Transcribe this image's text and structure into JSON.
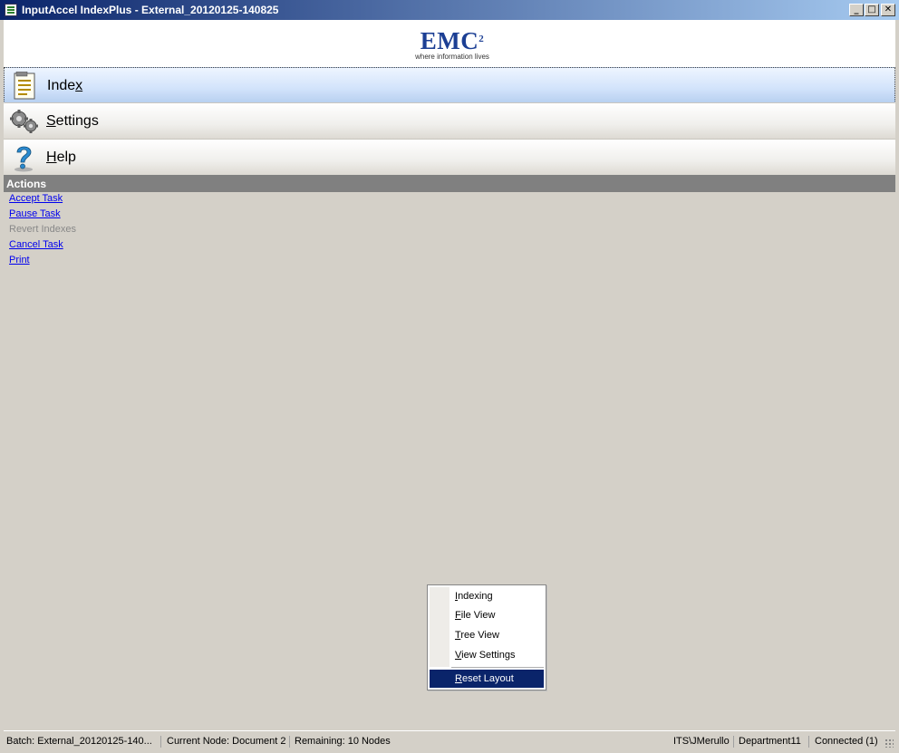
{
  "window": {
    "title": "InputAccel IndexPlus - External_20120125-140825",
    "controls": {
      "minimize": "_",
      "maximize": "□",
      "close": "✕"
    }
  },
  "logo": {
    "brand": "EMC",
    "superscript": "2",
    "tagline": "where information lives"
  },
  "nav": [
    {
      "label_pre": "Inde",
      "label_key": "x",
      "label_post": "",
      "icon": "document-icon",
      "selected": true
    },
    {
      "label_pre": "",
      "label_key": "S",
      "label_post": "ettings",
      "icon": "gears-icon",
      "selected": false
    },
    {
      "label_pre": "",
      "label_key": "H",
      "label_post": "elp",
      "icon": "question-icon",
      "selected": false
    }
  ],
  "actions": {
    "header": "Actions",
    "items": [
      {
        "label": "Accept Task",
        "enabled": true
      },
      {
        "label": "Pause Task",
        "enabled": true
      },
      {
        "label": "Revert Indexes",
        "enabled": false
      },
      {
        "label": "Cancel Task",
        "enabled": true
      },
      {
        "label": "Print",
        "enabled": true
      }
    ]
  },
  "context_menu": {
    "items": [
      {
        "key": "I",
        "rest": "ndexing"
      },
      {
        "key": "F",
        "rest": "ile View"
      },
      {
        "key": "T",
        "rest": "ree View"
      },
      {
        "key": "V",
        "rest": "iew Settings"
      }
    ],
    "highlighted": {
      "key": "R",
      "rest": "eset Layout"
    }
  },
  "status": {
    "batch": "Batch: External_20120125-140...",
    "current_node": "Current Node: Document 2",
    "remaining": "Remaining: 10 Nodes",
    "user": "ITS\\JMerullo",
    "department": "Department11",
    "connection": "Connected (1)"
  },
  "colors": {
    "title_gradient_start": "#0a246a",
    "title_gradient_end": "#a6caf0",
    "selected_nav": "#d2e3fb",
    "actions_header": "#808080",
    "link": "#0000ee",
    "menu_highlight": "#0a246a",
    "logo_blue": "#1c3f94"
  }
}
